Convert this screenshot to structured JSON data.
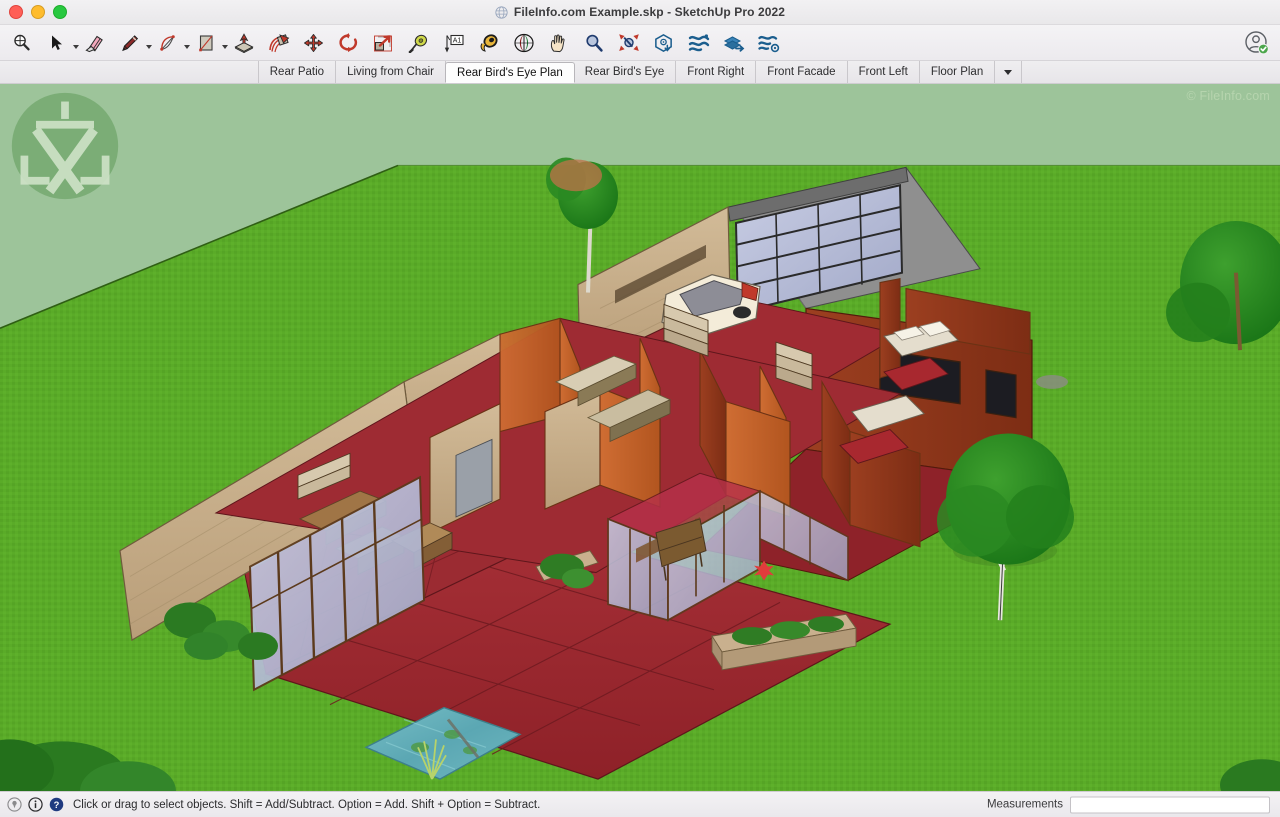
{
  "window": {
    "title": "FileInfo.com Example.skp - SketchUp Pro 2022",
    "doc_icon": "sketchup-document-icon",
    "controls": {
      "close": "close-window-button",
      "minimize": "minimize-window-button",
      "maximize": "maximize-window-button"
    }
  },
  "toolbar": {
    "items": [
      {
        "name": "search-tool",
        "icon": "magnifier-search-icon",
        "caret": false
      },
      {
        "name": "select-tool",
        "icon": "arrow-select-icon",
        "caret": true
      },
      {
        "name": "eraser-tool",
        "icon": "eraser-icon",
        "caret": false
      },
      {
        "name": "line-tool",
        "icon": "pencil-line-icon",
        "caret": true
      },
      {
        "name": "arc-tool",
        "icon": "arc-curve-icon",
        "caret": true
      },
      {
        "name": "rectangle-tool",
        "icon": "rectangle-shape-icon",
        "caret": true
      },
      {
        "name": "push-pull-tool",
        "icon": "push-pull-icon",
        "caret": false
      },
      {
        "name": "follow-me-tool",
        "icon": "follow-me-icon",
        "caret": false
      },
      {
        "name": "move-tool",
        "icon": "move-arrows-icon",
        "caret": false
      },
      {
        "name": "rotate-tool",
        "icon": "rotate-circular-icon",
        "caret": false
      },
      {
        "name": "scale-tool",
        "icon": "scale-arrow-icon",
        "caret": false
      },
      {
        "name": "tape-measure-tool",
        "icon": "tape-measure-icon",
        "caret": false
      },
      {
        "name": "dimension-tool",
        "icon": "dimension-a1-icon",
        "caret": false
      },
      {
        "name": "paint-bucket-tool",
        "icon": "paint-bucket-icon",
        "caret": false
      },
      {
        "name": "orbit-tool",
        "icon": "orbit-icon",
        "caret": false
      },
      {
        "name": "pan-tool",
        "icon": "hand-pan-icon",
        "caret": false
      },
      {
        "name": "zoom-tool",
        "icon": "zoom-magnifier-icon",
        "caret": false
      },
      {
        "name": "zoom-extents-tool",
        "icon": "zoom-extents-icon",
        "caret": false
      },
      {
        "name": "3d-warehouse",
        "icon": "warehouse-download-icon",
        "caret": false
      },
      {
        "name": "extension-warehouse",
        "icon": "extension-stack-icon",
        "caret": false
      },
      {
        "name": "trimble-connect",
        "icon": "layers-upload-icon",
        "caret": false
      },
      {
        "name": "manage-extensions",
        "icon": "extension-gear-icon",
        "caret": false
      }
    ],
    "account_icon": "user-account-verified-icon"
  },
  "scene_tabs": {
    "items": [
      {
        "label": "Rear Patio",
        "active": false
      },
      {
        "label": "Living from Chair",
        "active": false
      },
      {
        "label": "Rear Bird's Eye Plan",
        "active": true
      },
      {
        "label": "Rear Bird's Eye",
        "active": false
      },
      {
        "label": "Front Right",
        "active": false
      },
      {
        "label": "Front Facade",
        "active": false
      },
      {
        "label": "Front Left",
        "active": false
      },
      {
        "label": "Floor Plan",
        "active": false
      }
    ],
    "overflow_icon": "chevron-down-icon"
  },
  "viewport": {
    "watermark_text": "© FileInfo.com",
    "logo_icon": "sketchup-logo-watermark",
    "colors": {
      "sky_background": "#9dc49a",
      "lawn": "#5aab28",
      "lawn_dark": "#4d9a20",
      "driveway": "#8a8a8a",
      "patio_tile": "#9e2b32",
      "patio_tile_dark": "#8c2128",
      "floor_red": "#a02b33",
      "wall_terracotta": "#c4632e",
      "wall_brick": "#a8341f",
      "wall_stone": "#c9b08e",
      "wood_trim": "#8a4a22",
      "glass": "#b8bcd8",
      "tree_green": "#1f7a1f",
      "water": "#5aa8b4",
      "car_white": "#f2ead8"
    }
  },
  "status_bar": {
    "icons": [
      {
        "name": "geolocation-icon",
        "glyph": "location"
      },
      {
        "name": "info-icon",
        "glyph": "info"
      },
      {
        "name": "help-icon",
        "glyph": "help"
      }
    ],
    "message": "Click or drag to select objects. Shift = Add/Subtract. Option = Add. Shift + Option = Subtract.",
    "measurements_label": "Measurements",
    "measurements_value": ""
  }
}
